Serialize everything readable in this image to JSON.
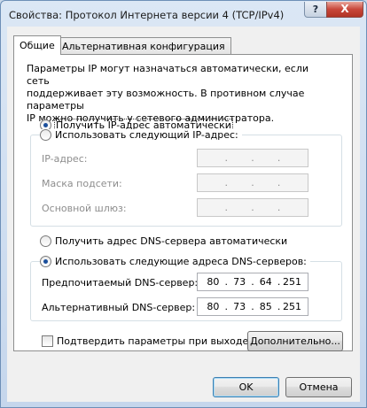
{
  "window": {
    "title": "Свойства: Протокол Интернета версии 4 (TCP/IPv4)",
    "help_label": "?",
    "close_label": "X"
  },
  "tabs": [
    {
      "label": "Общие",
      "selected": true
    },
    {
      "label": "Альтернативная конфигурация",
      "selected": false
    }
  ],
  "description": "Параметры IP могут назначаться автоматически, если сеть\nподдерживает эту возможность. В противном случае параметры\nIP можно получить у сетевого администратора.",
  "ip_mode": {
    "auto_label": "Получить IP-адрес автоматически",
    "manual_label": "Использовать следующий IP-адрес:",
    "selected": "auto",
    "fields": [
      {
        "label": "IP-адрес:",
        "octets": [
          "",
          "",
          "",
          ""
        ]
      },
      {
        "label": "Маска подсети:",
        "octets": [
          "",
          "",
          "",
          ""
        ]
      },
      {
        "label": "Основной шлюз:",
        "octets": [
          "",
          "",
          "",
          ""
        ]
      }
    ]
  },
  "dns_mode": {
    "auto_label": "Получить адрес DNS-сервера автоматически",
    "manual_label": "Использовать следующие адреса DNS-серверов:",
    "selected": "manual",
    "fields": [
      {
        "label": "Предпочитаемый DNS-сервер:",
        "octets": [
          "80",
          "73",
          "64",
          "251"
        ]
      },
      {
        "label": "Альтернативный DNS-сервер:",
        "octets": [
          "80",
          "73",
          "85",
          "251"
        ]
      }
    ]
  },
  "validate_on_exit": {
    "label": "Подтвердить параметры при выходе",
    "checked": false
  },
  "buttons": {
    "advanced": "Дополнительно...",
    "ok": "OK",
    "cancel": "Отмена"
  }
}
